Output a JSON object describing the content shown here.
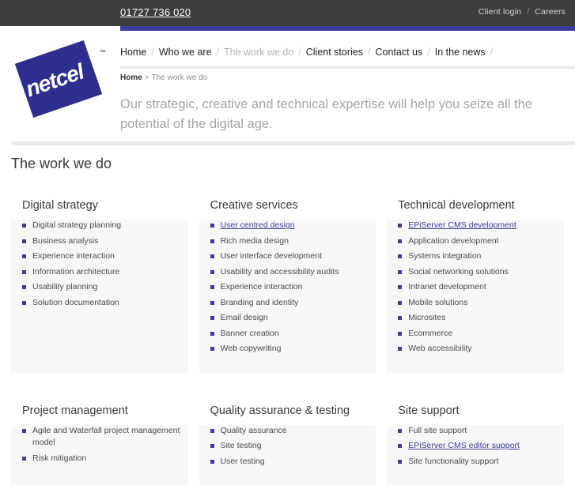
{
  "topbar": {
    "phone": "01727 736 020",
    "client_login": "Client login",
    "separator": "/",
    "careers": "Careers"
  },
  "logo": {
    "wordmark": "netcel",
    "tm": "™"
  },
  "nav": {
    "separator": "/",
    "items": [
      {
        "label": "Home",
        "active": false
      },
      {
        "label": "Who we are",
        "active": false
      },
      {
        "label": "The work we do",
        "active": true
      },
      {
        "label": "Client stories",
        "active": false
      },
      {
        "label": "Contact us",
        "active": false
      },
      {
        "label": "In the news",
        "active": false
      }
    ]
  },
  "breadcrumb": {
    "home": "Home",
    "arrow": ">",
    "current": "The work we do"
  },
  "tagline": "Our strategic, creative and technical expertise will help you seize all the potential of the digital age.",
  "page_title": "The work we do",
  "colors": {
    "brand_blue": "#3c3c9c",
    "logo_blue": "#2e2e8f",
    "topbar_dark": "#3d3d3d",
    "panel_bg": "#f7f7f7",
    "muted_text": "#a6a6a6"
  },
  "panels": [
    {
      "title": "Digital strategy",
      "items": [
        {
          "label": "Digital strategy planning",
          "link": false
        },
        {
          "label": "Business analysis",
          "link": false
        },
        {
          "label": "Experience interaction",
          "link": false
        },
        {
          "label": "Information architecture",
          "link": false
        },
        {
          "label": "Usability planning",
          "link": false
        },
        {
          "label": "Solution documentation",
          "link": false
        }
      ]
    },
    {
      "title": "Creative services",
      "items": [
        {
          "label": "User centred design",
          "link": true
        },
        {
          "label": "Rich media design",
          "link": false
        },
        {
          "label": "User interface development",
          "link": false
        },
        {
          "label": "Usability and accessibility audits",
          "link": false
        },
        {
          "label": "Experience interaction",
          "link": false
        },
        {
          "label": "Branding and identity",
          "link": false
        },
        {
          "label": "Email design",
          "link": false
        },
        {
          "label": "Banner creation",
          "link": false
        },
        {
          "label": "Web copywriting",
          "link": false
        }
      ]
    },
    {
      "title": "Technical development",
      "items": [
        {
          "label": "EPiServer CMS development",
          "link": true
        },
        {
          "label": "Application development",
          "link": false
        },
        {
          "label": "Systems integration",
          "link": false
        },
        {
          "label": "Social networking solutions",
          "link": false
        },
        {
          "label": "Intranet development",
          "link": false
        },
        {
          "label": "Mobile solutions",
          "link": false
        },
        {
          "label": "Microsites",
          "link": false
        },
        {
          "label": "Ecommerce",
          "link": false
        },
        {
          "label": "Web accessibility",
          "link": false
        }
      ]
    },
    {
      "title": "Project management",
      "items": [
        {
          "label": "Agile and Waterfall project management model",
          "link": false
        },
        {
          "label": "Risk mitigation",
          "link": false
        }
      ]
    },
    {
      "title": "Quality assurance & testing",
      "items": [
        {
          "label": "Quality assurance",
          "link": false
        },
        {
          "label": "Site testing",
          "link": false
        },
        {
          "label": "User testing",
          "link": false
        }
      ]
    },
    {
      "title": "Site support",
      "items": [
        {
          "label": "Full site support",
          "link": false
        },
        {
          "label": "EPiServer CMS editor support",
          "link": true
        },
        {
          "label": "Site functionality support",
          "link": false
        }
      ]
    }
  ]
}
